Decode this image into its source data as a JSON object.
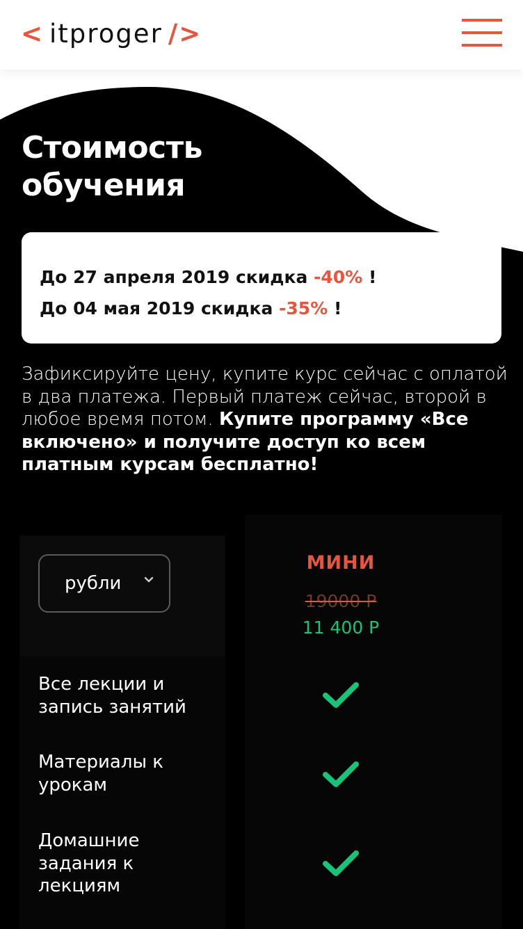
{
  "header": {
    "logo_left": "<",
    "logo_text": "itproger",
    "logo_right": "/>"
  },
  "pricing": {
    "title_line1": "Стоимость",
    "title_line2": "обучения",
    "discounts": [
      {
        "text": "До 27 апреля 2019 скидка ",
        "percent": "-40%",
        "suffix": " !"
      },
      {
        "text": "До 04 мая 2019 скидка ",
        "percent": "-35%",
        "suffix": " !"
      }
    ],
    "description": "Зафиксируйте цену, купите курс сейчас с оплатой в два платежа. Первый платеж сейчас, второй в любое время потом.",
    "description_bold": "Купите программу «Все включено» и получите доступ ко всем платным курсам бесплатно!"
  },
  "table": {
    "currency": "рубли",
    "plan": {
      "name": "МИНИ",
      "old_price": "19000 Р",
      "new_price": "11 400 Р"
    },
    "features": [
      {
        "label": "Все лекции и запись занятий",
        "included": true
      },
      {
        "label": "Материалы к урокам",
        "included": true
      },
      {
        "label": "Домашние задания к лекциям",
        "included": true
      }
    ]
  },
  "colors": {
    "accent": "#e8553d",
    "success": "#19c37a",
    "dark": "#000000"
  }
}
